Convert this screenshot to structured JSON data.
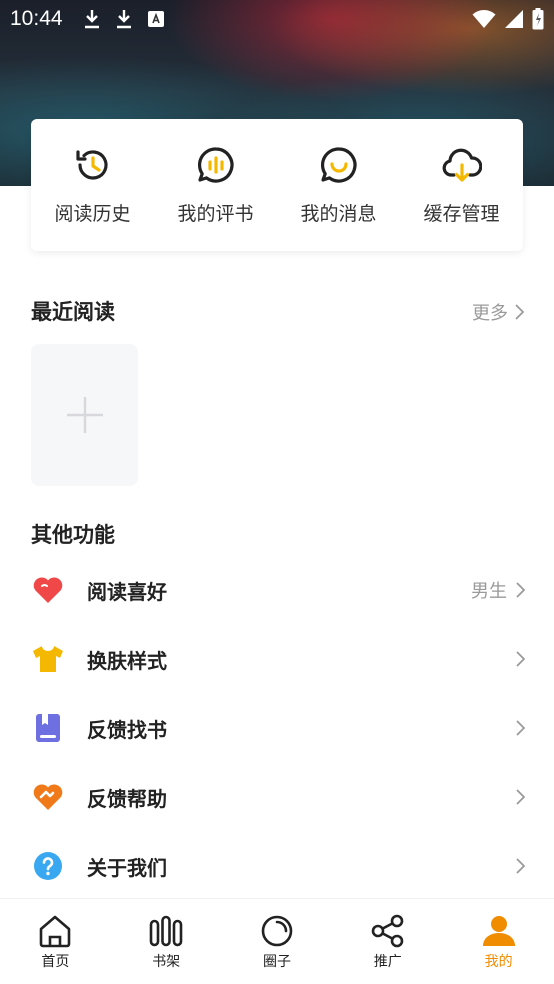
{
  "status_bar": {
    "time": "10:44"
  },
  "quick_menu": [
    {
      "label": "阅读历史",
      "icon": "history-icon"
    },
    {
      "label": "我的评书",
      "icon": "review-icon"
    },
    {
      "label": "我的消息",
      "icon": "message-icon"
    },
    {
      "label": "缓存管理",
      "icon": "cloud-download-icon"
    }
  ],
  "recent": {
    "title": "最近阅读",
    "more": "更多"
  },
  "other": {
    "title": "其他功能",
    "items": [
      {
        "label": "阅读喜好",
        "value": "男生",
        "icon": "heart-icon",
        "color": "#f04848"
      },
      {
        "label": "换肤样式",
        "value": "",
        "icon": "shirt-icon",
        "color": "#f5b800"
      },
      {
        "label": "反馈找书",
        "value": "",
        "icon": "book-icon",
        "color": "#6e6fe0"
      },
      {
        "label": "反馈帮助",
        "value": "",
        "icon": "help-heart-icon",
        "color": "#f07a1a"
      },
      {
        "label": "关于我们",
        "value": "",
        "icon": "question-icon",
        "color": "#3aa8f0"
      }
    ]
  },
  "bottom_nav": [
    {
      "label": "首页",
      "icon": "home-icon",
      "active": false
    },
    {
      "label": "书架",
      "icon": "bookshelf-icon",
      "active": false
    },
    {
      "label": "圈子",
      "icon": "circle-icon",
      "active": false
    },
    {
      "label": "推广",
      "icon": "share-icon",
      "active": false
    },
    {
      "label": "我的",
      "icon": "user-icon",
      "active": true
    }
  ],
  "colors": {
    "accent": "#f08c00",
    "icon_yellow": "#f5b800"
  }
}
